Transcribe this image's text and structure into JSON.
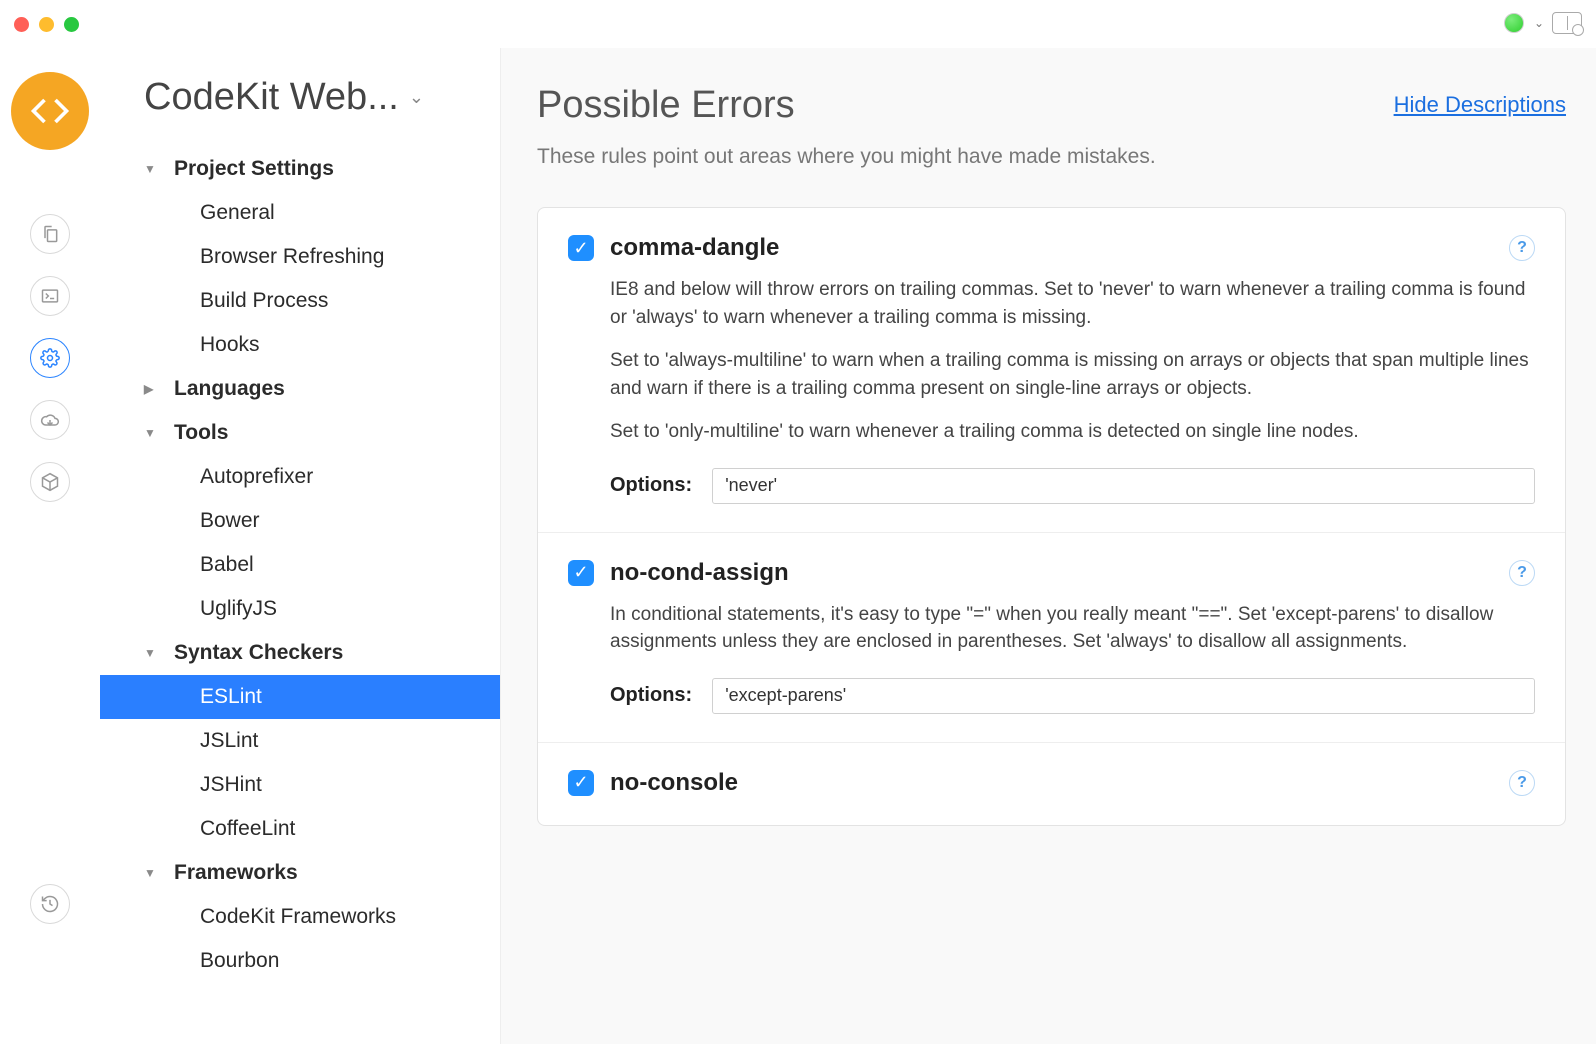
{
  "project": {
    "title": "CodeKit Web..."
  },
  "sidebar": {
    "sections": [
      {
        "label": "Project Settings",
        "expanded": true,
        "items": [
          {
            "label": "General"
          },
          {
            "label": "Browser Refreshing"
          },
          {
            "label": "Build Process"
          },
          {
            "label": "Hooks"
          }
        ]
      },
      {
        "label": "Languages",
        "expanded": false,
        "items": []
      },
      {
        "label": "Tools",
        "expanded": true,
        "items": [
          {
            "label": "Autoprefixer"
          },
          {
            "label": "Bower"
          },
          {
            "label": "Babel"
          },
          {
            "label": "UglifyJS"
          }
        ]
      },
      {
        "label": "Syntax Checkers",
        "expanded": true,
        "items": [
          {
            "label": "ESLint",
            "selected": true
          },
          {
            "label": "JSLint"
          },
          {
            "label": "JSHint"
          },
          {
            "label": "CoffeeLint"
          }
        ]
      },
      {
        "label": "Frameworks",
        "expanded": true,
        "items": [
          {
            "label": "CodeKit Frameworks"
          },
          {
            "label": "Bourbon"
          }
        ]
      }
    ]
  },
  "main": {
    "title": "Possible Errors",
    "hide_link": "Hide Descriptions",
    "subtitle": "These rules point out areas where you might have made mistakes.",
    "options_label": "Options:",
    "rules": [
      {
        "name": "comma-dangle",
        "checked": true,
        "desc": [
          "IE8 and below will throw errors on trailing commas. Set to 'never' to warn whenever a trailing comma is found or 'always' to warn whenever a trailing comma is missing.",
          "Set to 'always-multiline' to warn when a trailing comma is missing on arrays or objects that span multiple lines and warn if there is a trailing comma present on single-line arrays or objects.",
          "Set to 'only-multiline' to warn whenever a trailing comma is detected on single line nodes."
        ],
        "option_value": "'never'"
      },
      {
        "name": "no-cond-assign",
        "checked": true,
        "desc": [
          "In conditional statements, it's easy to type \"=\" when you really meant \"==\". Set 'except-parens' to disallow assignments unless they are enclosed in parentheses. Set 'always' to disallow all assignments."
        ],
        "option_value": "'except-parens'"
      },
      {
        "name": "no-console",
        "checked": true,
        "desc": [],
        "option_value": ""
      }
    ]
  }
}
